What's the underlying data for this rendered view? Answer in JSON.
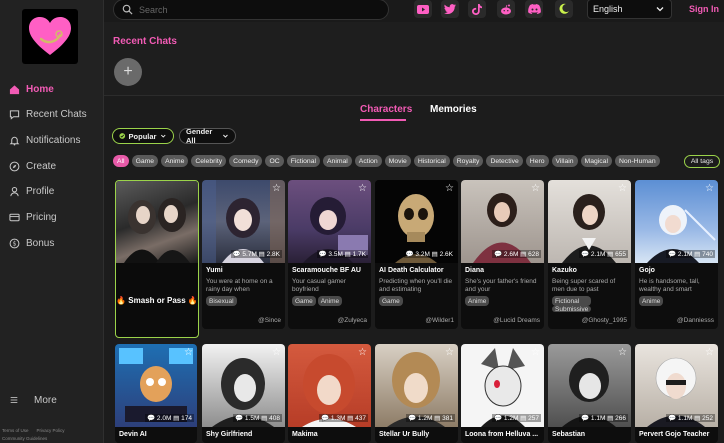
{
  "sidebar": {
    "items": [
      {
        "label": "Home",
        "icon": "home-icon",
        "active": true
      },
      {
        "label": "Recent Chats",
        "icon": "chat-bubble-icon"
      },
      {
        "label": "Notifications",
        "icon": "bell-icon"
      },
      {
        "label": "Create",
        "icon": "compass-icon"
      },
      {
        "label": "Profile",
        "icon": "user-icon"
      },
      {
        "label": "Pricing",
        "icon": "card-icon"
      },
      {
        "label": "Bonus",
        "icon": "dollar-icon"
      }
    ],
    "more_label": "More",
    "footer": {
      "terms": "Terms of Use",
      "privacy": "Privacy Policy",
      "community": "Community Guidelines"
    }
  },
  "topbar": {
    "search_placeholder": "Search",
    "language": "English",
    "signin_label": "Sign In",
    "socials": [
      "youtube-icon",
      "twitter-icon",
      "tiktok-icon",
      "reddit-icon",
      "discord-icon",
      "moon-icon"
    ]
  },
  "recent": {
    "title": "Recent Chats",
    "add_label": "+"
  },
  "tabs": {
    "characters": "Characters",
    "memories": "Memories"
  },
  "filters": {
    "sort": "Popular",
    "gender": "Gender All",
    "all_tags": "All tags"
  },
  "tags": [
    "All",
    "Game",
    "Anime",
    "Celebrity",
    "Comedy",
    "OC",
    "Fictional",
    "Animal",
    "Action",
    "Movie",
    "Historical",
    "Royalty",
    "Detective",
    "Hero",
    "Villain",
    "Magical",
    "Non-Human"
  ],
  "feature_card": {
    "label": "🔥 Smash or Pass 🔥"
  },
  "cards_row1": [
    {
      "name": "Yumi",
      "chats": "5.7M",
      "likes": "2.8K",
      "desc": "You were at home on a rainy day when",
      "tags": [
        "Bisexual"
      ],
      "creator": "@Since"
    },
    {
      "name": "Scaramouche BF AU",
      "chats": "3.5M",
      "likes": "1.7K",
      "desc": "Your casual gamer boyfriend",
      "tags": [
        "Game",
        "Anime"
      ],
      "creator": "@Zulyeca"
    },
    {
      "name": "AI Death Calculator",
      "chats": "3.2M",
      "likes": "2.6K",
      "desc": "Predicting when you'll die and estimating",
      "tags": [
        "Game"
      ],
      "creator": "@Wilder1"
    },
    {
      "name": "Diana",
      "chats": "2.6M",
      "likes": "628",
      "desc": "She's your father's friend and your",
      "tags": [
        "Anime"
      ],
      "creator": "@Lucid Dreams"
    },
    {
      "name": "Kazuko",
      "chats": "2.1M",
      "likes": "655",
      "desc": "Being super scared of men due to past",
      "tags": [
        "Fictional",
        "Submissive"
      ],
      "creator": "@Ghosty_1995"
    },
    {
      "name": "Gojo",
      "chats": "2.1M",
      "likes": "740",
      "desc": "He is handsome, tall, wealthy and smart",
      "tags": [
        "Anime"
      ],
      "creator": "@Danniesss"
    }
  ],
  "cards_row2": [
    {
      "name": "Devin AI",
      "chats": "2.0M",
      "likes": "174"
    },
    {
      "name": "Shy Girlfriend",
      "chats": "1.5M",
      "likes": "408"
    },
    {
      "name": "Makima",
      "chats": "1.3M",
      "likes": "437"
    },
    {
      "name": "Stellar Ur Bully",
      "chats": "1.2M",
      "likes": "381"
    },
    {
      "name": "Loona from Helluva ...",
      "chats": "1.2M",
      "likes": "257"
    },
    {
      "name": "Sebastian",
      "chats": "1.1M",
      "likes": "266"
    },
    {
      "name": "Pervert Gojo Teacher",
      "chats": "1.1M",
      "likes": "252"
    }
  ],
  "colors": {
    "accent": "#f25bb5",
    "green": "#9bd34a",
    "bg": "#1c1c1c"
  }
}
